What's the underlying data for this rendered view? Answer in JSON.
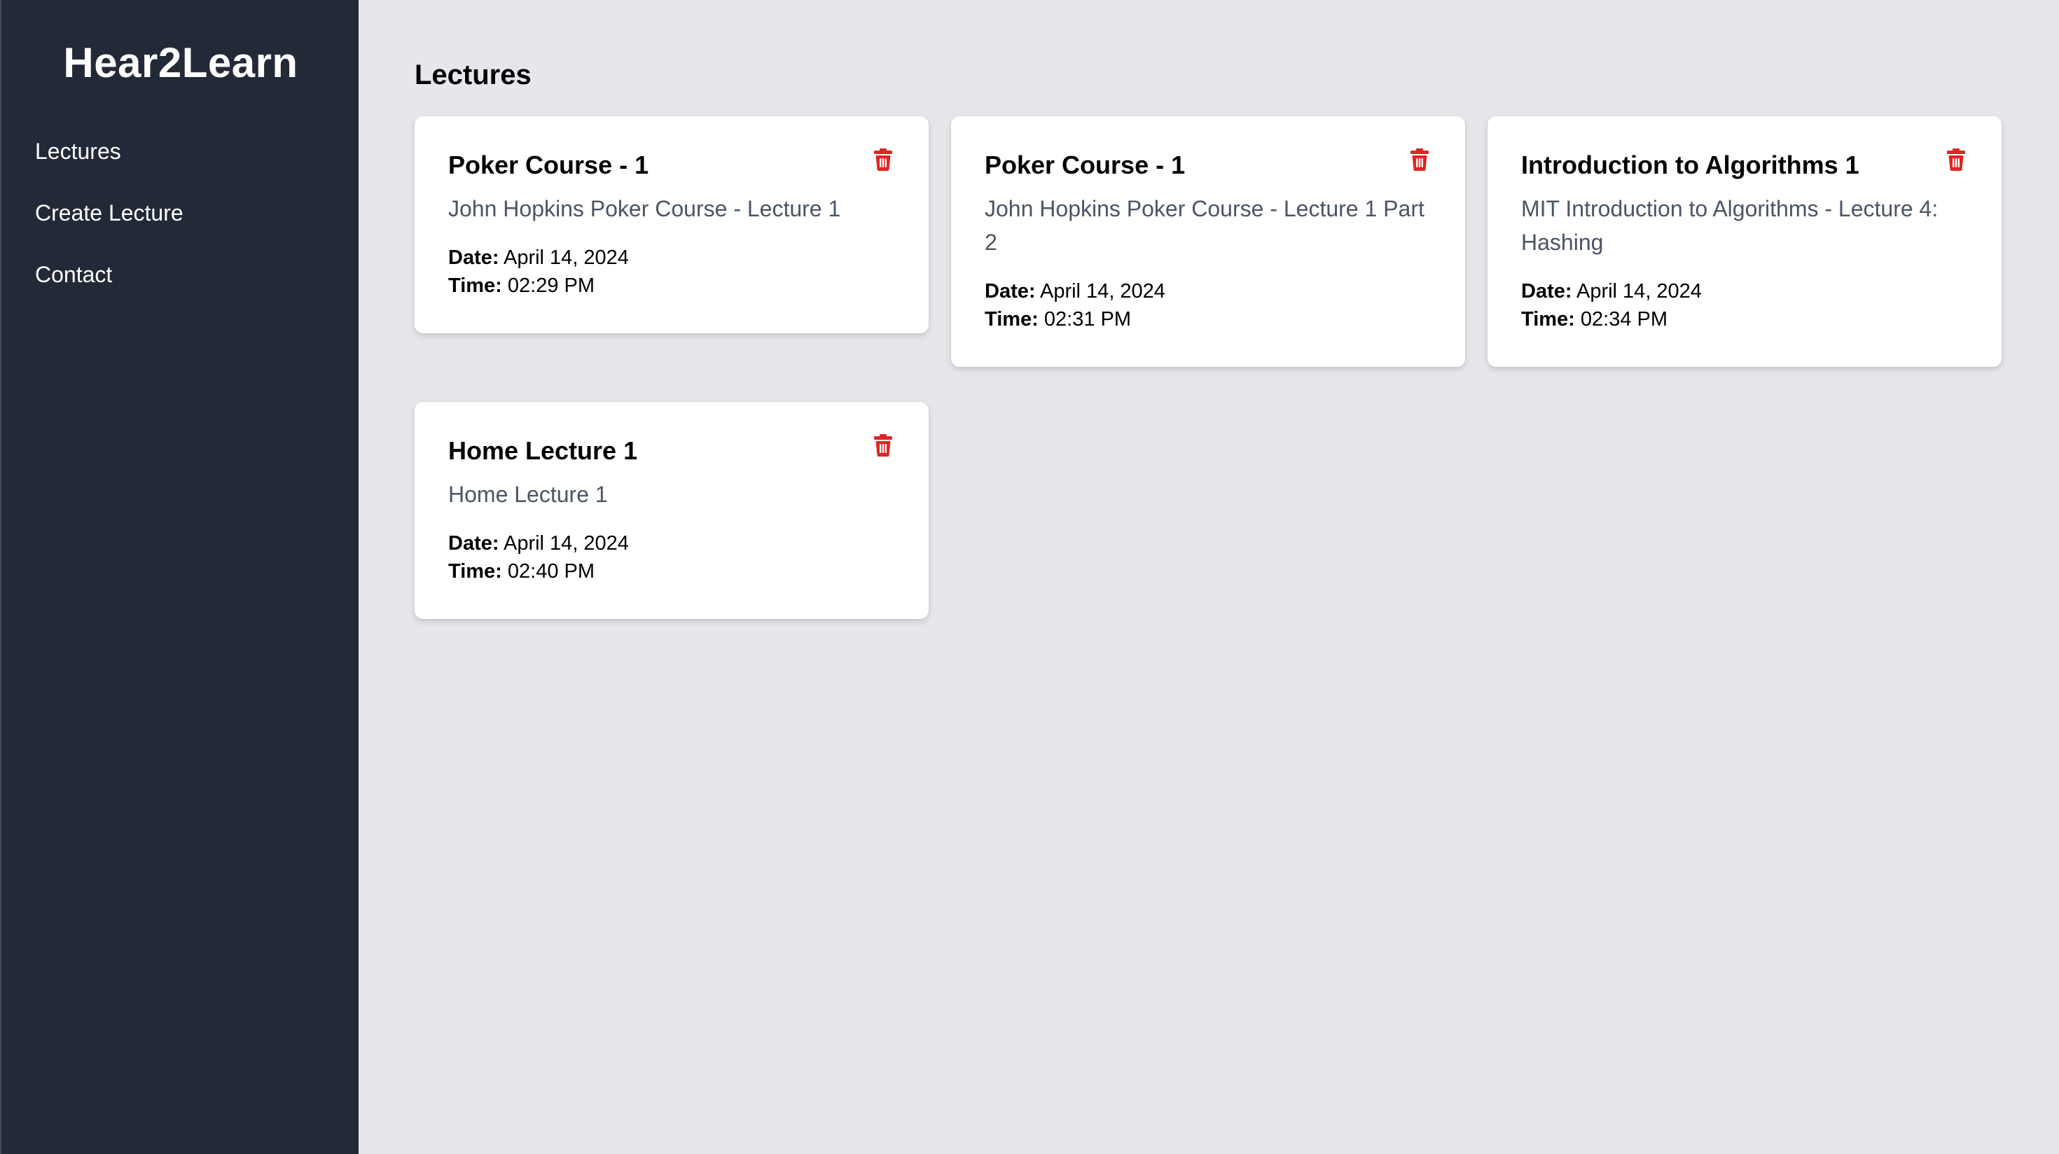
{
  "sidebar": {
    "brand": "Hear2Learn",
    "items": [
      {
        "label": "Lectures"
      },
      {
        "label": "Create Lecture"
      },
      {
        "label": "Contact"
      }
    ]
  },
  "main": {
    "title": "Lectures",
    "date_label": "Date:",
    "time_label": "Time:",
    "delete_icon_color": "#dc2626",
    "lectures": [
      {
        "title": "Poker Course - 1",
        "description": "John Hopkins Poker Course - Lecture 1",
        "date": "April 14, 2024",
        "time": "02:29 PM"
      },
      {
        "title": "Poker Course - 1",
        "description": "John Hopkins Poker Course - Lecture 1 Part 2",
        "date": "April 14, 2024",
        "time": "02:31 PM"
      },
      {
        "title": "Introduction to Algorithms 1",
        "description": "MIT Introduction to Algorithms - Lecture 4: Hashing",
        "date": "April 14, 2024",
        "time": "02:34 PM"
      },
      {
        "title": "Home Lecture 1",
        "description": "Home Lecture 1",
        "date": "April 14, 2024",
        "time": "02:40 PM"
      }
    ]
  }
}
